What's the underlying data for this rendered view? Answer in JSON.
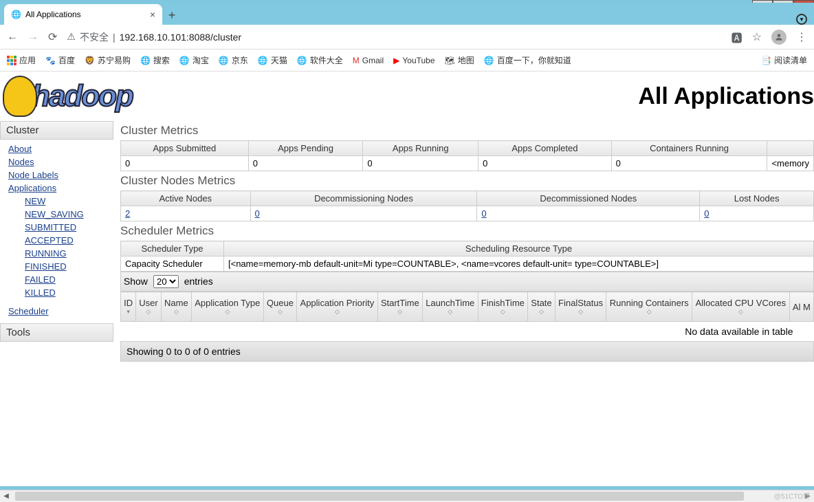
{
  "window": {
    "min": "—",
    "max": "□",
    "close": "✕"
  },
  "tab": {
    "title": "All Applications"
  },
  "addr": {
    "insecure": "不安全",
    "url": "192.168.10.101:8088/cluster"
  },
  "bookmarks": {
    "apps": "应用",
    "items": [
      "百度",
      "苏宁易购",
      "搜索",
      "淘宝",
      "京东",
      "天猫",
      "软件大全",
      "Gmail",
      "YouTube",
      "地图",
      "百度一下，你就知道"
    ],
    "readlist": "阅读清单"
  },
  "page": {
    "title": "All Applications",
    "sidebar": {
      "cluster": "Cluster",
      "links": [
        "About",
        "Nodes",
        "Node Labels",
        "Applications"
      ],
      "states": [
        "NEW",
        "NEW_SAVING",
        "SUBMITTED",
        "ACCEPTED",
        "RUNNING",
        "FINISHED",
        "FAILED",
        "KILLED"
      ],
      "scheduler": "Scheduler",
      "tools": "Tools"
    },
    "cluster_metrics": {
      "title": "Cluster Metrics",
      "headers": [
        "Apps Submitted",
        "Apps Pending",
        "Apps Running",
        "Apps Completed",
        "Containers Running",
        ""
      ],
      "values": [
        "0",
        "0",
        "0",
        "0",
        "0",
        "<memory"
      ]
    },
    "nodes_metrics": {
      "title": "Cluster Nodes Metrics",
      "headers": [
        "Active Nodes",
        "Decommissioning Nodes",
        "Decommissioned Nodes",
        "Lost Nodes"
      ],
      "values": [
        "2",
        "0",
        "0",
        "0"
      ]
    },
    "scheduler_metrics": {
      "title": "Scheduler Metrics",
      "headers": [
        "Scheduler Type",
        "Scheduling Resource Type"
      ],
      "values": [
        "Capacity Scheduler",
        "[<name=memory-mb default-unit=Mi type=COUNTABLE>, <name=vcores default-unit= type=COUNTABLE>]"
      ]
    },
    "dt": {
      "show": "Show",
      "entries": "entries",
      "len": "20",
      "cols": [
        "ID",
        "User",
        "Name",
        "Application Type",
        "Queue",
        "Application Priority",
        "StartTime",
        "LaunchTime",
        "FinishTime",
        "State",
        "FinalStatus",
        "Running Containers",
        "Allocated CPU VCores",
        "Al M"
      ],
      "nodata": "No data available in table",
      "info": "Showing 0 to 0 of 0 entries"
    }
  },
  "watermark": "@51CTO博"
}
